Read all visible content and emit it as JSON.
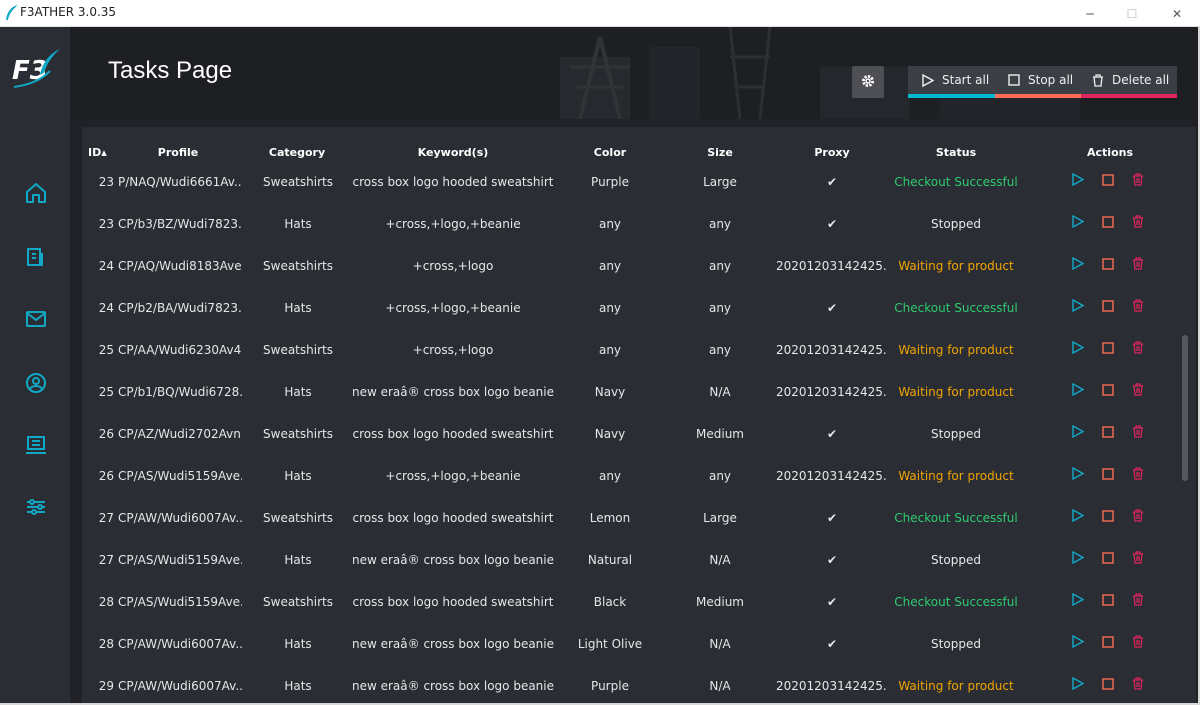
{
  "window": {
    "title": "F3ATHER 3.0.35",
    "minimize": "─",
    "maximize": "☐",
    "close": "✕"
  },
  "logo": {
    "text": "F3"
  },
  "header": {
    "title": "Tasks Page"
  },
  "toolbar": {
    "start_all": "Start all",
    "stop_all": "Stop all",
    "delete_all": "Delete all",
    "colors": {
      "start": "#00b7d4",
      "stop": "#ff6b55",
      "delete": "#e0245e"
    }
  },
  "columns": {
    "id": "ID▴",
    "profile": "Profile",
    "category": "Category",
    "keywords": "Keyword(s)",
    "color": "Color",
    "size": "Size",
    "proxy": "Proxy",
    "status": "Status",
    "actions": "Actions"
  },
  "rows": [
    {
      "id": "23",
      "profile": "P/NAQ/Wudi6661Av...",
      "category": "Sweatshirts",
      "keyword": "cross box logo hooded sweatshirt",
      "color": "Purple",
      "size": "Large",
      "proxy": "✔",
      "status": "Checkout Successful",
      "status_type": "success"
    },
    {
      "id": "23",
      "profile": "CP/b3/BZ/Wudi7823...",
      "category": "Hats",
      "keyword": "+cross,+logo,+beanie",
      "color": "any",
      "size": "any",
      "proxy": "✔",
      "status": "Stopped",
      "status_type": "stopped"
    },
    {
      "id": "24",
      "profile": "CP/AQ/Wudi8183Ave...",
      "category": "Sweatshirts",
      "keyword": "+cross,+logo",
      "color": "any",
      "size": "any",
      "proxy": "20201203142425...",
      "status": "Waiting for product",
      "status_type": "waiting"
    },
    {
      "id": "24",
      "profile": "CP/b2/BA/Wudi7823...",
      "category": "Hats",
      "keyword": "+cross,+logo,+beanie",
      "color": "any",
      "size": "any",
      "proxy": "✔",
      "status": "Checkout Successful",
      "status_type": "success"
    },
    {
      "id": "25",
      "profile": "CP/AA/Wudi6230Av4...",
      "category": "Sweatshirts",
      "keyword": "+cross,+logo",
      "color": "any",
      "size": "any",
      "proxy": "20201203142425...",
      "status": "Waiting for product",
      "status_type": "waiting"
    },
    {
      "id": "25",
      "profile": "CP/b1/BQ/Wudi6728...",
      "category": "Hats",
      "keyword": "new eraâ® cross box logo beanie",
      "color": "Navy",
      "size": "N/A",
      "proxy": "20201203142425...",
      "status": "Waiting for product",
      "status_type": "waiting"
    },
    {
      "id": "26",
      "profile": "CP/AZ/Wudi2702Avn...",
      "category": "Sweatshirts",
      "keyword": "cross box logo hooded sweatshirt",
      "color": "Navy",
      "size": "Medium",
      "proxy": "✔",
      "status": "Stopped",
      "status_type": "stopped"
    },
    {
      "id": "26",
      "profile": "CP/AS/Wudi5159Ave...",
      "category": "Hats",
      "keyword": "+cross,+logo,+beanie",
      "color": "any",
      "size": "any",
      "proxy": "20201203142425...",
      "status": "Waiting for product",
      "status_type": "waiting"
    },
    {
      "id": "27",
      "profile": "CP/AW/Wudi6007Av...",
      "category": "Sweatshirts",
      "keyword": "cross box logo hooded sweatshirt",
      "color": "Lemon",
      "size": "Large",
      "proxy": "✔",
      "status": "Checkout Successful",
      "status_type": "success"
    },
    {
      "id": "27",
      "profile": "CP/AS/Wudi5159Ave...",
      "category": "Hats",
      "keyword": "new eraâ® cross box logo beanie",
      "color": "Natural",
      "size": "N/A",
      "proxy": "✔",
      "status": "Stopped",
      "status_type": "stopped"
    },
    {
      "id": "28",
      "profile": "CP/AS/Wudi5159Ave...",
      "category": "Sweatshirts",
      "keyword": "cross box logo hooded sweatshirt",
      "color": "Black",
      "size": "Medium",
      "proxy": "✔",
      "status": "Checkout Successful",
      "status_type": "success"
    },
    {
      "id": "28",
      "profile": "CP/AW/Wudi6007Av...",
      "category": "Hats",
      "keyword": "new eraâ® cross box logo beanie",
      "color": "Light Olive",
      "size": "N/A",
      "proxy": "✔",
      "status": "Stopped",
      "status_type": "stopped"
    },
    {
      "id": "29",
      "profile": "CP/AW/Wudi6007Av...",
      "category": "Hats",
      "keyword": "new eraâ® cross box logo beanie",
      "color": "Purple",
      "size": "N/A",
      "proxy": "20201203142425...",
      "status": "Waiting for product",
      "status_type": "waiting"
    }
  ],
  "icons": {
    "nav": [
      "home-icon",
      "tasks-icon",
      "mail-icon",
      "profile-icon",
      "proxies-icon",
      "settings-sliders-icon"
    ],
    "row_actions": [
      "play-icon",
      "stop-icon",
      "trash-icon"
    ]
  },
  "colors": {
    "accent": "#00b7d4",
    "success": "#2ecc71",
    "waiting": "#f0a500",
    "danger": "#e0245e"
  }
}
